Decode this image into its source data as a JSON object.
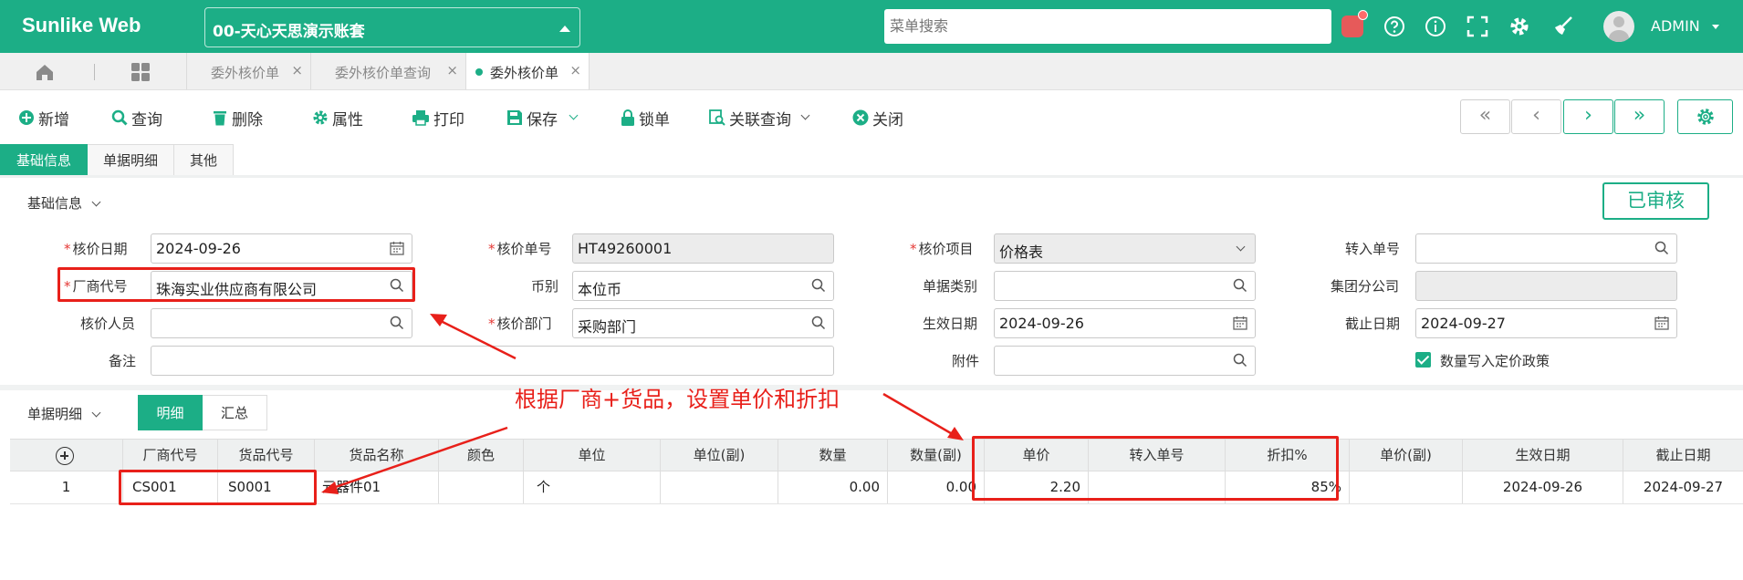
{
  "app": {
    "brand": "Sunlike Web",
    "account": "00-天心天思演示账套",
    "menu_search_placeholder": "菜单搜索",
    "user": "ADMIN"
  },
  "tabs": [
    {
      "label": "委外核价单"
    },
    {
      "label": "委外核价单查询"
    },
    {
      "label": "委外核价单"
    }
  ],
  "toolbar": {
    "add": "新增",
    "query": "查询",
    "delete": "删除",
    "properties": "属性",
    "print": "打印",
    "save": "保存",
    "lock": "锁单",
    "related_query": "关联查询",
    "close": "关闭"
  },
  "nav": {
    "first": "«",
    "prev": "‹",
    "next": "›",
    "last": "»"
  },
  "section_tabs": [
    "基础信息",
    "单据明细",
    "其他"
  ],
  "basic": {
    "title": "基础信息",
    "status": "已审核",
    "fields": {
      "date_label": "核价日期",
      "date": "2024-09-26",
      "no_label": "核价单号",
      "no": "HT49260001",
      "item_label": "核价项目",
      "item": "价格表",
      "in_no_label": "转入单号",
      "in_no": "",
      "vendor_label": "厂商代号",
      "vendor": "珠海实业供应商有限公司",
      "currency_label": "币别",
      "currency": "本位币",
      "type_label": "单据类别",
      "type": "",
      "group_label": "集团分公司",
      "group": "",
      "staff_label": "核价人员",
      "staff": "",
      "dept_label": "核价部门",
      "dept": "采购部门",
      "eff_label": "生效日期",
      "eff": "2024-09-26",
      "end_label": "截止日期",
      "end": "2024-09-27",
      "note_label": "备注",
      "note": "",
      "attach_label": "附件",
      "attach": "",
      "checkbox_label": "数量写入定价政策"
    }
  },
  "detail": {
    "title": "单据明细",
    "tabs": [
      "明细",
      "汇总"
    ],
    "columns": [
      "厂商代号",
      "货品代号",
      "货品名称",
      "颜色",
      "单位",
      "单位(副)",
      "数量",
      "数量(副)",
      "单价",
      "转入单号",
      "折扣%",
      "单价(副)",
      "生效日期",
      "截止日期"
    ],
    "rows": [
      {
        "idx": "1",
        "vendor": "CS001",
        "prd": "S0001",
        "name": "元器件01",
        "color": "",
        "unit": "个",
        "unit2": "",
        "qty": "0.00",
        "qty2": "0.00",
        "price": "2.20",
        "in_no": "",
        "disc": "85%",
        "price2": "",
        "eff": "2024-09-26",
        "end": "2024-09-27"
      }
    ]
  },
  "annotation": "根据厂商+货品，设置单价和折扣",
  "colors": {
    "primary": "#1cae86",
    "annotation": "#e8201a"
  }
}
